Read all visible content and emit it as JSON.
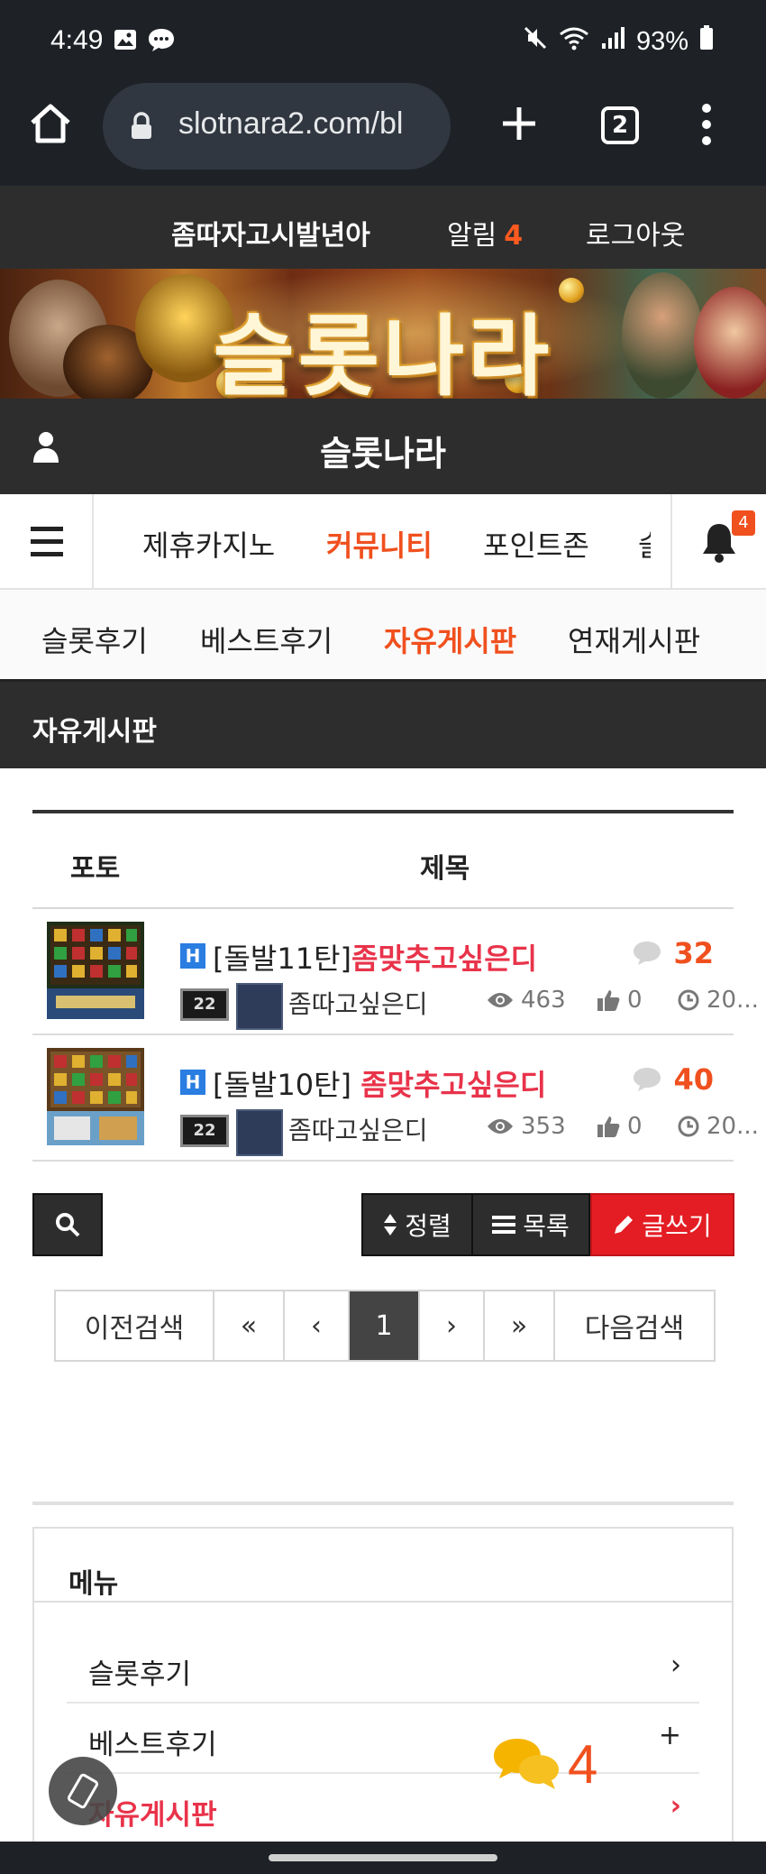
{
  "status_bar": {
    "time": "4:49",
    "battery": "93%",
    "icons": [
      "image-icon",
      "chat-bubble-icon",
      "mute-icon",
      "wifi-icon",
      "signal-icon",
      "battery-icon"
    ]
  },
  "browser": {
    "url": "slotnara2.com/bl",
    "tab_count": "2",
    "icons": [
      "home-icon",
      "lock-icon",
      "plus-icon",
      "more-icon"
    ]
  },
  "top_nav": {
    "nickname": "좀따자고시발년아",
    "alarm_label": "알림",
    "alarm_count": "4",
    "logout_label": "로그아웃"
  },
  "banner": {
    "title": "슬롯나라"
  },
  "site_header": {
    "title": "슬롯나라"
  },
  "main_nav": {
    "items": [
      {
        "label": "제휴카지노",
        "active": false
      },
      {
        "label": "커뮤니티",
        "active": true
      },
      {
        "label": "포인트존",
        "active": false
      },
      {
        "label": "슬",
        "active": false
      }
    ],
    "bell_badge": "4"
  },
  "sub_nav": {
    "items": [
      {
        "label": "슬롯후기",
        "active": false
      },
      {
        "label": "베스트후기",
        "active": false
      },
      {
        "label": "자유게시판",
        "active": true
      },
      {
        "label": "연재게시판",
        "active": false
      }
    ]
  },
  "board": {
    "title": "자유게시판",
    "headers": {
      "photo": "포토",
      "title": "제목"
    },
    "posts": [
      {
        "tag": "[돌발11탄]",
        "title": "좀맞추고싶은디",
        "comments": "32",
        "level": "22",
        "author": "좀따고싶은디",
        "views": "463",
        "likes": "0",
        "date": "20..."
      },
      {
        "tag": "[돌발10탄]",
        "title": "좀맞추고싶은디",
        "comments": "40",
        "level": "22",
        "author": "좀따고싶은디",
        "views": "353",
        "likes": "0",
        "date": "20..."
      }
    ]
  },
  "toolbar": {
    "sort_label": "정렬",
    "list_label": "목록",
    "write_label": "글쓰기"
  },
  "pagination": {
    "prev_search": "이전검색",
    "first": "«",
    "prev": "‹",
    "current": "1",
    "next": "›",
    "last": "»",
    "next_search": "다음검색"
  },
  "side_menu": {
    "title": "메뉴",
    "items": [
      {
        "label": "슬롯후기",
        "arrow": "›"
      },
      {
        "label": "베스트후기",
        "arrow": "+"
      },
      {
        "label": "자유게시판",
        "arrow": "›"
      }
    ]
  },
  "floating": {
    "chat_count": "4"
  },
  "colors": {
    "accent_orange": "#f0501e",
    "highlight_red": "#e8334a",
    "write_button": "#e41d24",
    "dark_bg": "#2d2d2d",
    "status_bg": "#1e2227"
  }
}
